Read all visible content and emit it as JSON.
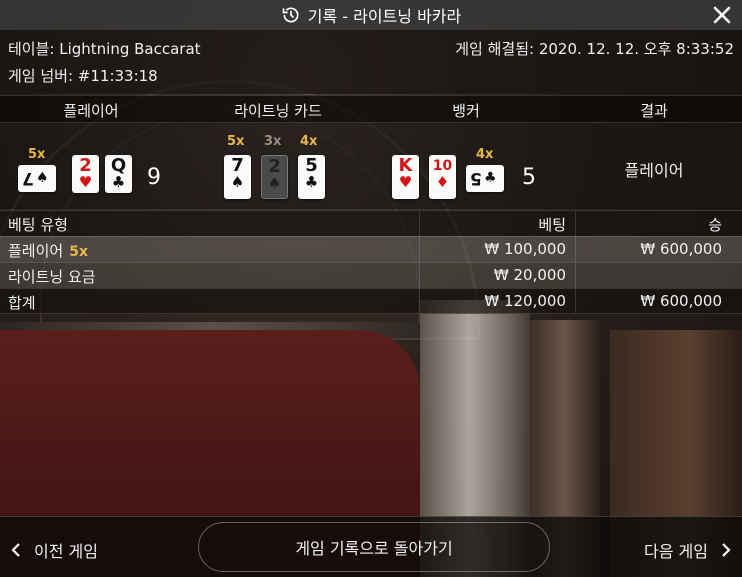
{
  "title": "기록 - 라이트닝 바카라",
  "info": {
    "table_label": "테이블: Lightning Baccarat",
    "game_number_label": "게임 넘버: #11:33:18",
    "resolved_label": "게임 해결됨: 2020. 12. 12. 오후 8:33:52"
  },
  "headers": {
    "player": "플레이어",
    "lightning_cards": "라이트닝 카드",
    "banker": "뱅커",
    "result": "결과"
  },
  "player": {
    "cards": [
      {
        "rank": "7",
        "suit": "♠",
        "color": "black",
        "multiplier": "5x",
        "sideways": true
      },
      {
        "rank": "2",
        "suit": "♥",
        "color": "red",
        "multiplier": ""
      },
      {
        "rank": "Q",
        "suit": "♣",
        "color": "black",
        "multiplier": ""
      }
    ],
    "score": "9"
  },
  "lightning": {
    "cards": [
      {
        "rank": "7",
        "suit": "♠",
        "color": "black",
        "multiplier": "5x"
      },
      {
        "rank": "2",
        "suit": "♠",
        "color": "dim",
        "multiplier": "3x"
      },
      {
        "rank": "5",
        "suit": "♣",
        "color": "black",
        "multiplier": "4x"
      }
    ]
  },
  "banker": {
    "cards": [
      {
        "rank": "K",
        "suit": "♥",
        "color": "red",
        "multiplier": ""
      },
      {
        "rank": "10",
        "suit": "♦",
        "color": "red",
        "multiplier": ""
      },
      {
        "rank": "5",
        "suit": "♣",
        "color": "black",
        "multiplier": "4x",
        "sideways": true
      }
    ],
    "score": "5"
  },
  "result": "플레이어",
  "bets": {
    "header": {
      "type": "베팅 유형",
      "bet": "베팅",
      "win": "승"
    },
    "rows": [
      {
        "type": "플레이어",
        "multiplier": "5x",
        "bet": "₩ 100,000",
        "win": "₩ 600,000"
      },
      {
        "type": "라이트닝 요금",
        "multiplier": "",
        "bet": "₩ 20,000",
        "win": ""
      },
      {
        "type": "합계",
        "multiplier": "",
        "bet": "₩ 120,000",
        "win": "₩ 600,000"
      }
    ]
  },
  "footer": {
    "prev": "이전 게임",
    "back": "게임 기록으로 돌아가기",
    "next": "다음 게임"
  },
  "colors": {
    "multiplier": "#e8b84a",
    "red_suit": "#d41616"
  },
  "icons": {
    "title": "history-icon",
    "close": "close-icon",
    "prev": "chevron-left-icon",
    "next": "chevron-right-icon"
  }
}
